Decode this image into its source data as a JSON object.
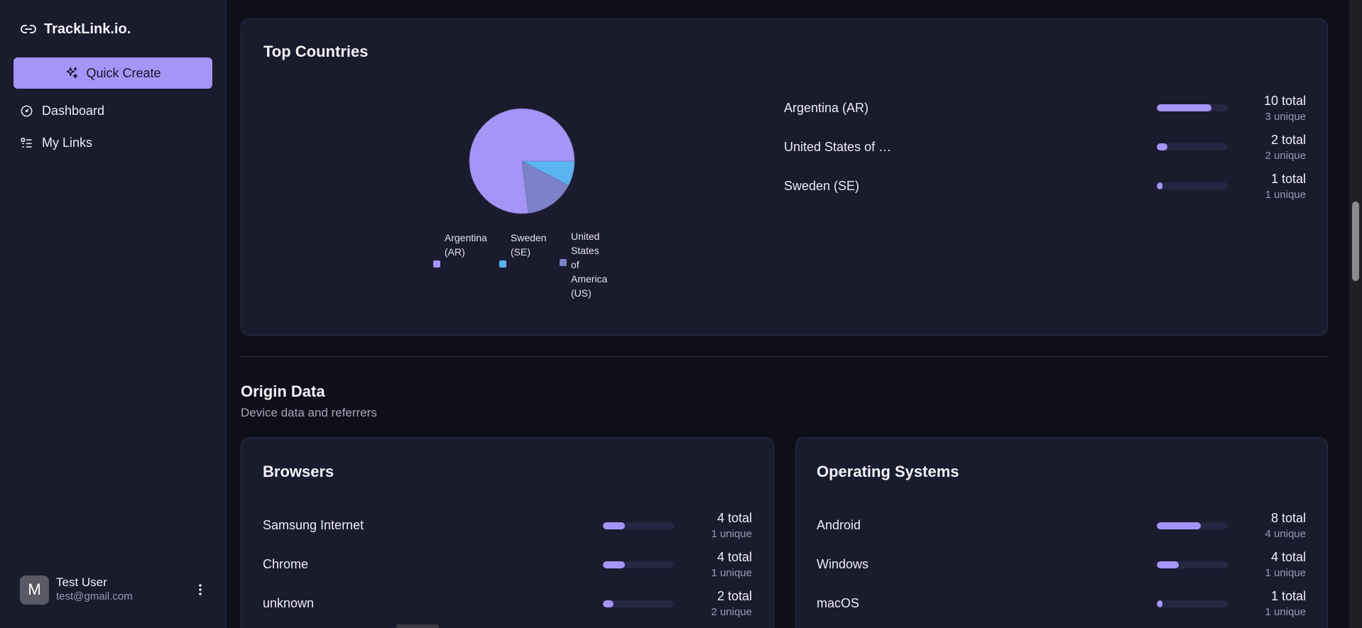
{
  "app": {
    "brand": "TrackLink.io."
  },
  "sidebar": {
    "quick_create": "Quick Create",
    "items": [
      {
        "label": "Dashboard",
        "icon": "gauge-icon"
      },
      {
        "label": "My Links",
        "icon": "list-icon"
      }
    ],
    "user": {
      "initial": "M",
      "name": "Test User",
      "email": "test@gmail.com"
    }
  },
  "top_countries": {
    "title": "Top Countries",
    "legend": [
      {
        "name": "Argentina (AR)",
        "lines": [
          "Argentina",
          "(AR)"
        ],
        "color": "#a694f7"
      },
      {
        "name": "Sweden (SE)",
        "lines": [
          "Sweden",
          "(SE)"
        ],
        "color": "#5ab4f0"
      },
      {
        "name": "United States of America (US)",
        "lines": [
          "United",
          "States",
          "of",
          "America",
          "(US)"
        ],
        "color": "#7c82c8"
      }
    ],
    "rows": [
      {
        "label": "Argentina (AR)",
        "total": "10 total",
        "unique": "3 unique",
        "fraction": 0.77
      },
      {
        "label": "United States of …",
        "total": "2 total",
        "unique": "2 unique",
        "fraction": 0.15
      },
      {
        "label": "Sweden (SE)",
        "total": "1 total",
        "unique": "1 unique",
        "fraction": 0.08
      }
    ]
  },
  "chart_data": {
    "type": "pie",
    "categories": [
      "Argentina (AR)",
      "Sweden (SE)",
      "United States of America (US)"
    ],
    "values": [
      10,
      1,
      2
    ],
    "colors": [
      "#a694f7",
      "#5ab4f0",
      "#7c82c8"
    ],
    "legend_position": "bottom"
  },
  "origin": {
    "title": "Origin Data",
    "subtitle": "Device data and referrers"
  },
  "browsers": {
    "title": "Browsers",
    "rows": [
      {
        "label": "Samsung Internet",
        "total": "4 total",
        "unique": "1 unique",
        "fraction": 0.31
      },
      {
        "label": "Chrome",
        "total": "4 total",
        "unique": "1 unique",
        "fraction": 0.31
      },
      {
        "label": "unknown",
        "total": "2 total",
        "unique": "2 unique",
        "fraction": 0.15
      }
    ]
  },
  "operating_systems": {
    "title": "Operating Systems",
    "rows": [
      {
        "label": "Android",
        "total": "8 total",
        "unique": "4 unique",
        "fraction": 0.62
      },
      {
        "label": "Windows",
        "total": "4 total",
        "unique": "1 unique",
        "fraction": 0.31
      },
      {
        "label": "macOS",
        "total": "1 total",
        "unique": "1 unique",
        "fraction": 0.08
      }
    ]
  }
}
